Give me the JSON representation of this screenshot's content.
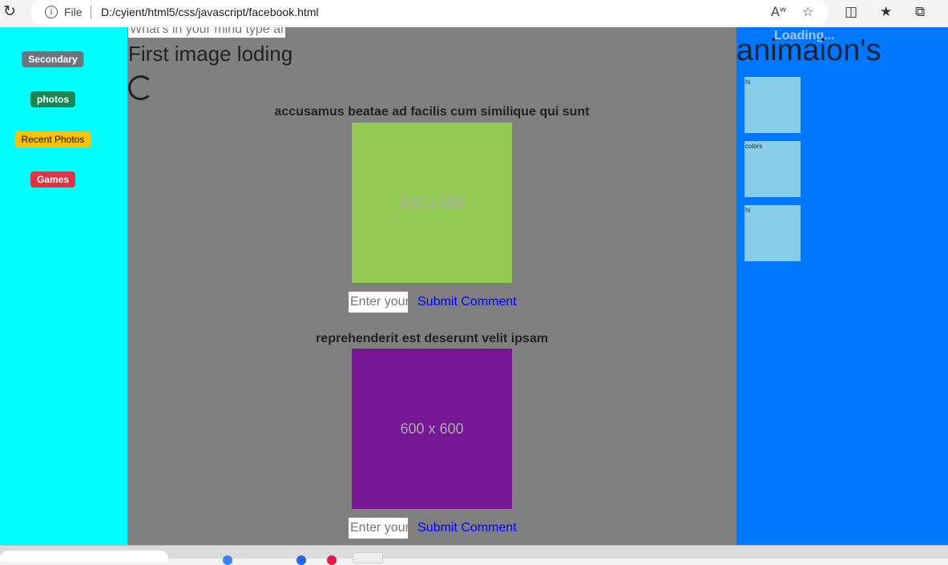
{
  "browser": {
    "scheme": "File",
    "url": "D:/cyient/html5/css/javascript/facebook.html"
  },
  "sidebar": {
    "items": [
      {
        "label": "Secondary",
        "color": "#6c757d"
      },
      {
        "label": "photos",
        "color": "#198754"
      },
      {
        "label": "Recent Photos",
        "color": "#ffc107"
      },
      {
        "label": "Games",
        "color": "#dc3545"
      }
    ]
  },
  "main": {
    "post_placeholder": "What's in your mind type anything",
    "heading": "First image loding",
    "cards": [
      {
        "title": "accusamus beatae ad facilis cum similique qui sunt",
        "image_text": "600 x 600",
        "image_color": "#92c952",
        "comment_placeholder": "Enter your comment",
        "submit_label": "Submit Comment"
      },
      {
        "title": "reprehenderit est deserunt velit ipsam",
        "image_text": "600 x 600",
        "image_color": "#771796",
        "comment_placeholder": "Enter your comment",
        "submit_label": "Submit Comment"
      }
    ]
  },
  "right": {
    "loading": "Loading...",
    "title": "animaion's",
    "tiles": [
      {
        "label": "hi"
      },
      {
        "label": "colors"
      },
      {
        "label": "hi"
      }
    ]
  }
}
